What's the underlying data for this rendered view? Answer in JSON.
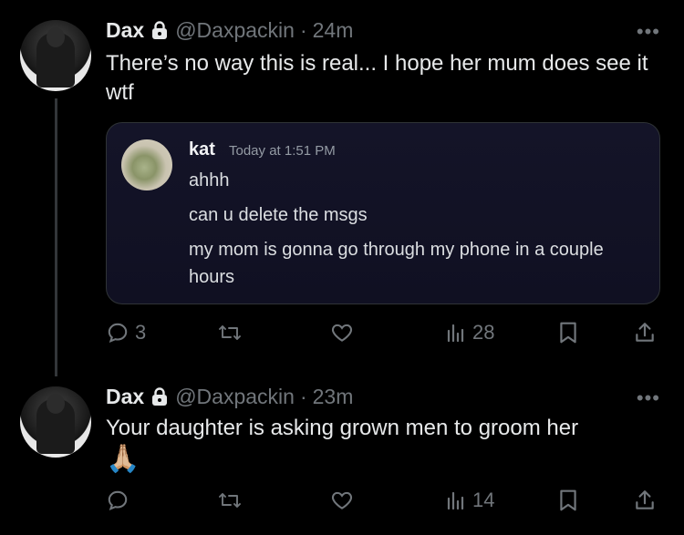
{
  "tweets": [
    {
      "name": "Dax",
      "handle": "@Daxpackin",
      "dot": "·",
      "time": "24m",
      "text": "There’s no way this is real... I hope her mum does see it wtf",
      "quote": {
        "name": "kat",
        "time": "Today at 1:51 PM",
        "lines": [
          "ahhh",
          "can u delete the msgs",
          "my mom is gonna go through my phone in a couple hours"
        ]
      },
      "replies": "3",
      "retweets": "",
      "likes": "",
      "views": "28"
    },
    {
      "name": "Dax",
      "handle": "@Daxpackin",
      "dot": "·",
      "time": "23m",
      "text": "Your daughter is asking grown men to groom her",
      "emoji": "🙏🏼",
      "replies": "",
      "retweets": "",
      "likes": "",
      "views": "14"
    }
  ],
  "more_label": "•••",
  "colors": {
    "background": "#000000",
    "text": "#e7e9ea",
    "muted": "#71767b",
    "quote_bg": "#141428"
  }
}
